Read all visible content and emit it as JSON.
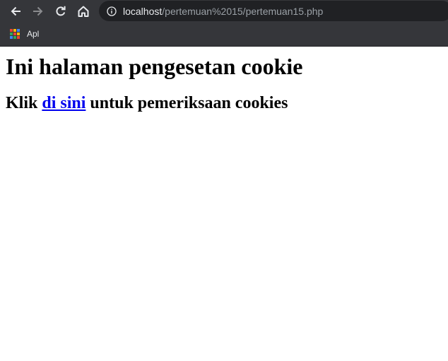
{
  "browser": {
    "url_host": "localhost",
    "url_path": "/pertemuan%2015/pertemuan15.php",
    "bookmarks": [
      {
        "label": "Apl",
        "icon": "apps-grid-icon"
      }
    ],
    "colors": {
      "chrome": "#35363a",
      "omnibox": "#202124",
      "icon": "#e8eaed",
      "icon_disabled": "#8a8b8e"
    }
  },
  "page": {
    "heading": "Ini halaman pengesetan cookie",
    "line_prefix": "Klik",
    "link_text": "di sini",
    "line_suffix": "untuk pemeriksaan cookies",
    "link_color": "#0000ee"
  }
}
